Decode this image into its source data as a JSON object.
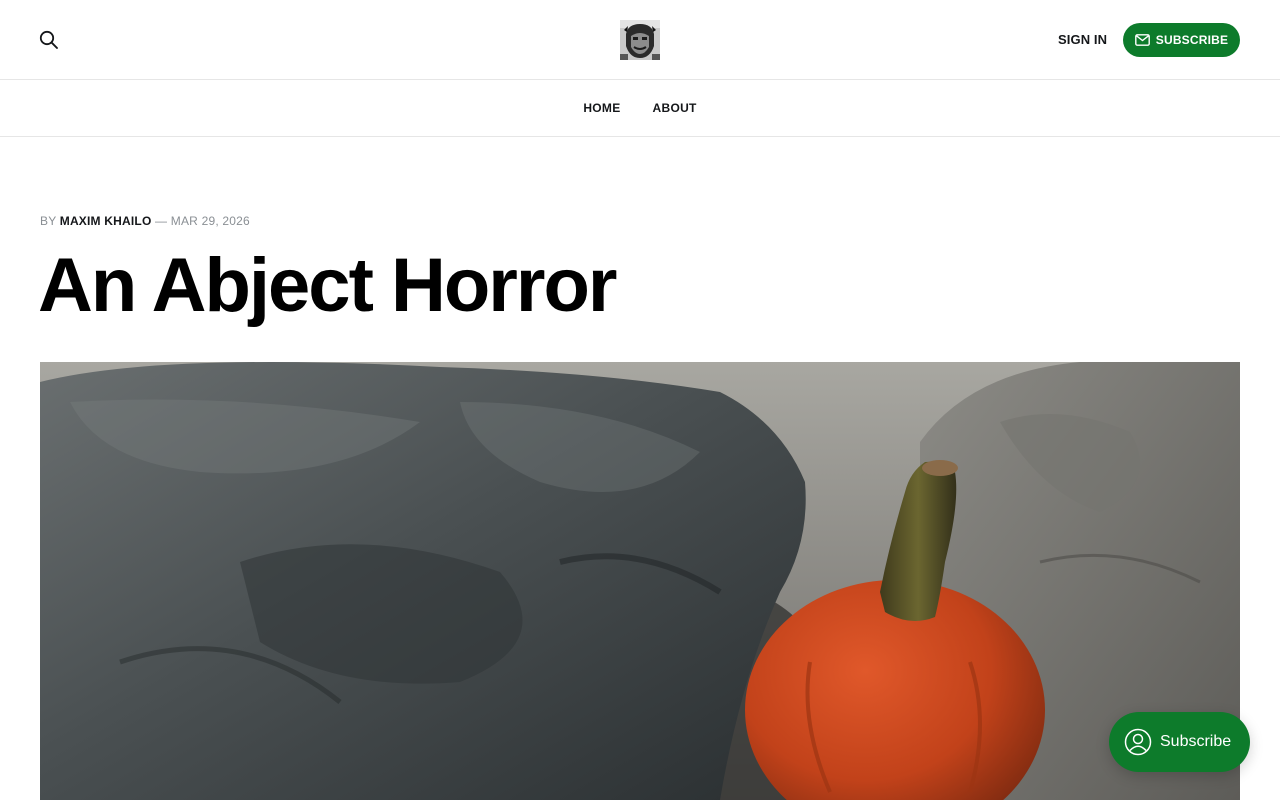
{
  "header": {
    "search_icon": "search-icon",
    "logo_icon": "logo-image",
    "sign_in_label": "SIGN IN",
    "subscribe_label": "SUBSCRIBE",
    "subscribe_icon": "mail-icon",
    "accent_color": "#0d7b2b"
  },
  "nav": {
    "items": [
      {
        "label": "HOME"
      },
      {
        "label": "ABOUT"
      }
    ]
  },
  "article": {
    "by_prefix": "BY",
    "author": "MAXIM KHAILO",
    "separator": "—",
    "date": "MAR 29, 2026",
    "title": "An Abject Horror",
    "feature_image": "photo of a small orange pumpkin resting against dark wet rocks on gray sand"
  },
  "portal": {
    "label": "Subscribe",
    "icon": "user-circle-icon"
  }
}
